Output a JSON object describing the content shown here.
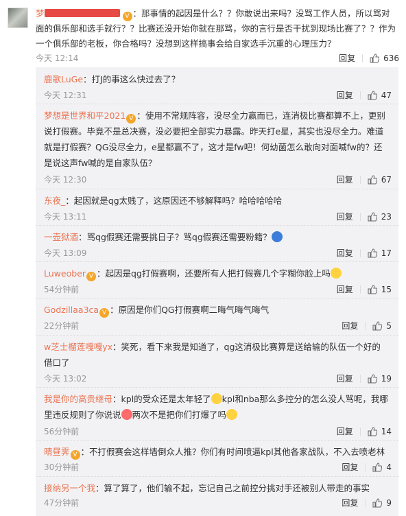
{
  "main_comment": {
    "user_prefix": "梦",
    "text": "：那事情的起因是什么？？你敢说出来吗？没骂工作人员，所以骂对面的俱乐部和选手就行？？比赛还没开始你就在那骂，你的言行是否干扰到现场比赛了？？作为一个俱乐部的老板，你合格吗？没想到这样搞事会给自家选手沉重的心理压力？",
    "time": "今天 12:14",
    "reply_label": "回复",
    "likes": "636"
  },
  "replies": [
    {
      "user": "鹿歌LuGe",
      "badge": false,
      "text": "：打J的事这么快过去了？",
      "time": "今天 12:31",
      "reply_label": "回复",
      "likes": "47"
    },
    {
      "user": "梦想是世界和平2021",
      "badge": true,
      "text": "：使用不常规阵容，没尽全力赢而已，连消极比赛都算不上，更别说打假赛。毕竟不是总决赛，没必要把全部实力暴露。昨天打e星，其实也没尽全力。难道就是打假赛？QG没尽全力，e星都赢不了，这才是fw吧！何幼菌怎么敢向对面喊fw的？还是说这声fw喊的是自家队伍？",
      "time": "今天 12:30",
      "reply_label": "回复",
      "likes": "67"
    },
    {
      "user": "东夜_",
      "badge": false,
      "text": "：起因就是qg太贱了，这原因还不够解释吗？哈哈哈哈哈",
      "time": "今天 13:11",
      "reply_label": "回复",
      "likes": "23"
    },
    {
      "user": "一壶狱酒",
      "badge": false,
      "text": "：骂qg假赛还需要挑日子？骂qg假赛还需要粉籍？",
      "time": "今天 13:09",
      "reply_label": "回复",
      "likes": "17"
    },
    {
      "user": "Luweober",
      "badge": true,
      "text": "：起因是qg打假赛啊，还要所有人把打假赛几个字糊你脸上吗",
      "time": "54分钟前",
      "reply_label": "回复",
      "likes": "15"
    },
    {
      "user": "Godzillaa3ca",
      "badge": true,
      "text": "：原因是你们QG打假赛啊二晦气晦气晦气",
      "time": "22分钟前",
      "reply_label": "回复",
      "likes": "5"
    },
    {
      "user": "w芝士榴莲嘎嘎yx",
      "badge": false,
      "text": "：笑死，看下来我是知道了，qg这消极比赛算是送给输的队伍一个好的借口了",
      "time": "今天 13:02",
      "reply_label": "回复",
      "likes": "19"
    },
    {
      "user": "我是你的高贵继母",
      "badge": false,
      "text": "：kpl的受众还是太年轻了",
      "text2": "kpl和nba那么多控分的怎么没人骂呢，我哪里违反规则了你说说",
      "text3": "两次不是把你们打爆了吗",
      "time": "56分钟前",
      "reply_label": "回复",
      "likes": "14"
    },
    {
      "user": "晴昼霁",
      "badge": true,
      "text": "：不打假赛会这样墙倒众人推？你们有时间喷逼kpl其他各家战队，不入去喷老林",
      "time": "30分钟前",
      "reply_label": "回复",
      "likes": "4"
    },
    {
      "user": "接纳另一个我",
      "badge": false,
      "text": "：算了算了，他们输不起，忘记自己之前控分挑对手还被别人带走的事实",
      "time": "47分钟前",
      "reply_label": "回复",
      "likes": "9"
    }
  ]
}
